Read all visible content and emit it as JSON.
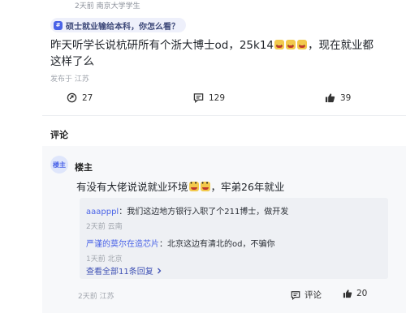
{
  "post": {
    "meta_top": "2天前 南京大学学生",
    "topic_label": "硕士就业输给本科，你怎么看？",
    "text_part1": "昨天听学长说杭研所有个浙大博士od，25k14",
    "text_part2": "，现在就业都这样了么",
    "location_meta": "发布于 江苏"
  },
  "actions": {
    "repost_count": "27",
    "comment_count": "129",
    "like_count": "39"
  },
  "comments_section": {
    "title": "评论"
  },
  "comment": {
    "avatar_label": "楼主",
    "author": "楼主",
    "text_part1": "有没有大佬说说就业环境",
    "text_part2": "，牢弟26年就业",
    "replies": [
      {
        "author": "aaapppl",
        "text": "：我们这边地方银行入职了个211博士，做开发",
        "meta": "2天前 云南"
      },
      {
        "author": "严谨的莫尔在造芯片",
        "text": "：北京这边有清北的od，不骗你",
        "meta": "1天前 北京"
      }
    ],
    "view_all": "查看全部11条回复",
    "footer_meta": "2天前 江苏",
    "reply_label": "评论",
    "like_count": "20"
  }
}
